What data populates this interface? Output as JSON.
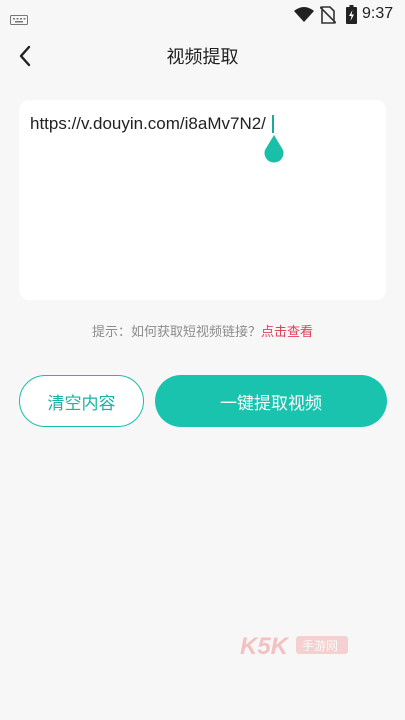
{
  "status_bar": {
    "time": "9:37",
    "icons": [
      "keyboard-icon",
      "wifi-icon",
      "no-sim-icon",
      "battery-charging-icon"
    ]
  },
  "header": {
    "back_icon": "back-arrow-icon",
    "title": "视频提取"
  },
  "url_input": {
    "value": "https://v.douyin.com/i8aMv7N2/"
  },
  "tip": {
    "prefix": "提示：如何获取短视频链接？",
    "link": "点击查看"
  },
  "actions": {
    "clear_label": "清空内容",
    "extract_label": "一键提取视频"
  },
  "watermark": {
    "brand": "K5K",
    "text": "手游网",
    "icon": "watermark-logo"
  },
  "colors": {
    "accent": "#19c3ae",
    "accent_dark": "#18b3a0",
    "link": "#e0405a",
    "background": "#f7f7f7",
    "card": "#ffffff"
  }
}
